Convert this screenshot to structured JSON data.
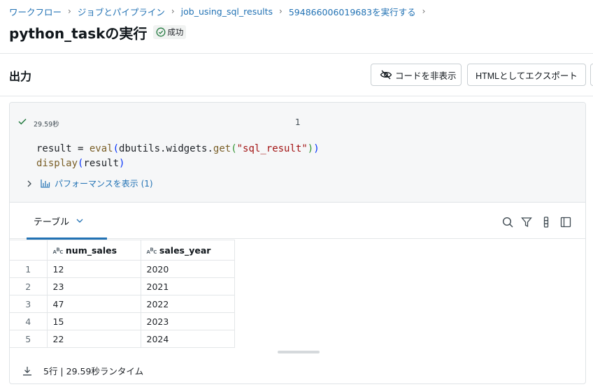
{
  "breadcrumb": {
    "items": [
      "ワークフロー",
      "ジョブとパイプライン",
      "job_using_sql_results",
      "594866006019683を実行する"
    ],
    "separator": "›"
  },
  "page": {
    "title": "python_taskの実行",
    "status": "成功"
  },
  "output": {
    "title": "出力",
    "hide_code_label": "コードを非表示",
    "export_label": "HTMLとしてエクスポート"
  },
  "cell": {
    "exec_time": "29.59秒",
    "number": "1",
    "code_lines": [
      "result = eval(dbutils.widgets.get(\"sql_result\"))",
      "display(result)"
    ],
    "performance_label": "パフォーマンスを表示 (1)"
  },
  "results": {
    "tab_label": "テーブル",
    "columns": [
      "num_sales",
      "sales_year"
    ],
    "rows": [
      {
        "index": "1",
        "num_sales": "12",
        "sales_year": "2020"
      },
      {
        "index": "2",
        "num_sales": "23",
        "sales_year": "2021"
      },
      {
        "index": "3",
        "num_sales": "47",
        "sales_year": "2022"
      },
      {
        "index": "4",
        "num_sales": "15",
        "sales_year": "2023"
      },
      {
        "index": "5",
        "num_sales": "22",
        "sales_year": "2024"
      }
    ],
    "footer_text": "5行 | 29.59秒ランタイム"
  },
  "colors": {
    "link": "#2272b4",
    "success": "#277c43",
    "tab_active": "#2272b4"
  },
  "icons": [
    "check-icon",
    "eye-off-icon",
    "chevron-right-icon",
    "bar-chart-icon",
    "chevron-down-icon",
    "search-icon",
    "filter-icon",
    "column-settings-icon",
    "sidebar-panel-icon",
    "download-icon"
  ]
}
